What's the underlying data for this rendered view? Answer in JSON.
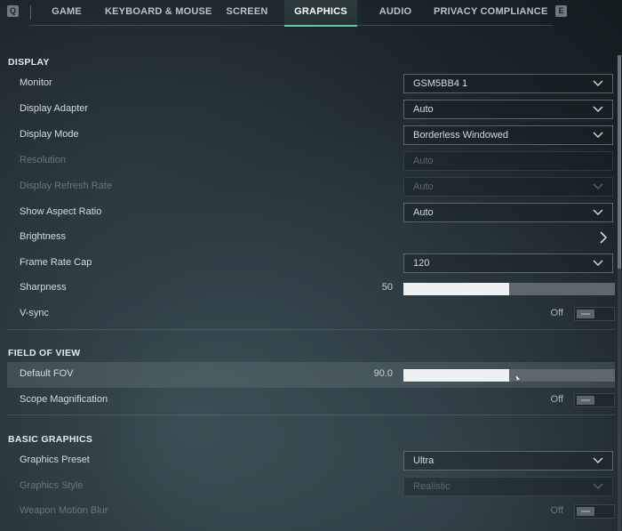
{
  "tabs": {
    "left_key": "Q",
    "right_key": "E",
    "items": [
      {
        "label": "GAME"
      },
      {
        "label": "KEYBOARD & MOUSE"
      },
      {
        "label": "SCREEN"
      },
      {
        "label": "GRAPHICS"
      },
      {
        "label": "AUDIO"
      },
      {
        "label": "PRIVACY COMPLIANCE"
      }
    ],
    "active": "GRAPHICS",
    "accent_color": "#4fd2a0"
  },
  "display": {
    "title": "DISPLAY",
    "monitor": {
      "label": "Monitor",
      "value": "GSM5BB4 1"
    },
    "display_adapter": {
      "label": "Display Adapter",
      "value": "Auto"
    },
    "display_mode": {
      "label": "Display Mode",
      "value": "Borderless Windowed"
    },
    "resolution": {
      "label": "Resolution",
      "value": "Auto",
      "disabled": true
    },
    "refresh_rate": {
      "label": "Display Refresh Rate",
      "value": "Auto",
      "disabled": true
    },
    "aspect_ratio": {
      "label": "Show Aspect Ratio",
      "value": "Auto"
    },
    "brightness": {
      "label": "Brightness"
    },
    "frame_rate_cap": {
      "label": "Frame Rate Cap",
      "value": "120"
    },
    "sharpness": {
      "label": "Sharpness",
      "value": "50",
      "fill_fraction": 0.5
    },
    "vsync": {
      "label": "V-sync",
      "value": "Off"
    }
  },
  "fov": {
    "title": "FIELD OF VIEW",
    "default_fov": {
      "label": "Default FOV",
      "value": "90.0",
      "fill_fraction": 0.5
    },
    "scope_magnification": {
      "label": "Scope Magnification",
      "value": "Off"
    }
  },
  "basic": {
    "title": "BASIC GRAPHICS",
    "graphics_preset": {
      "label": "Graphics Preset",
      "value": "Ultra"
    },
    "graphics_style": {
      "label": "Graphics Style",
      "value": "Realistic",
      "disabled": true
    },
    "weapon_motion_blur": {
      "label": "Weapon Motion Blur",
      "value": "Off",
      "disabled": true
    }
  }
}
